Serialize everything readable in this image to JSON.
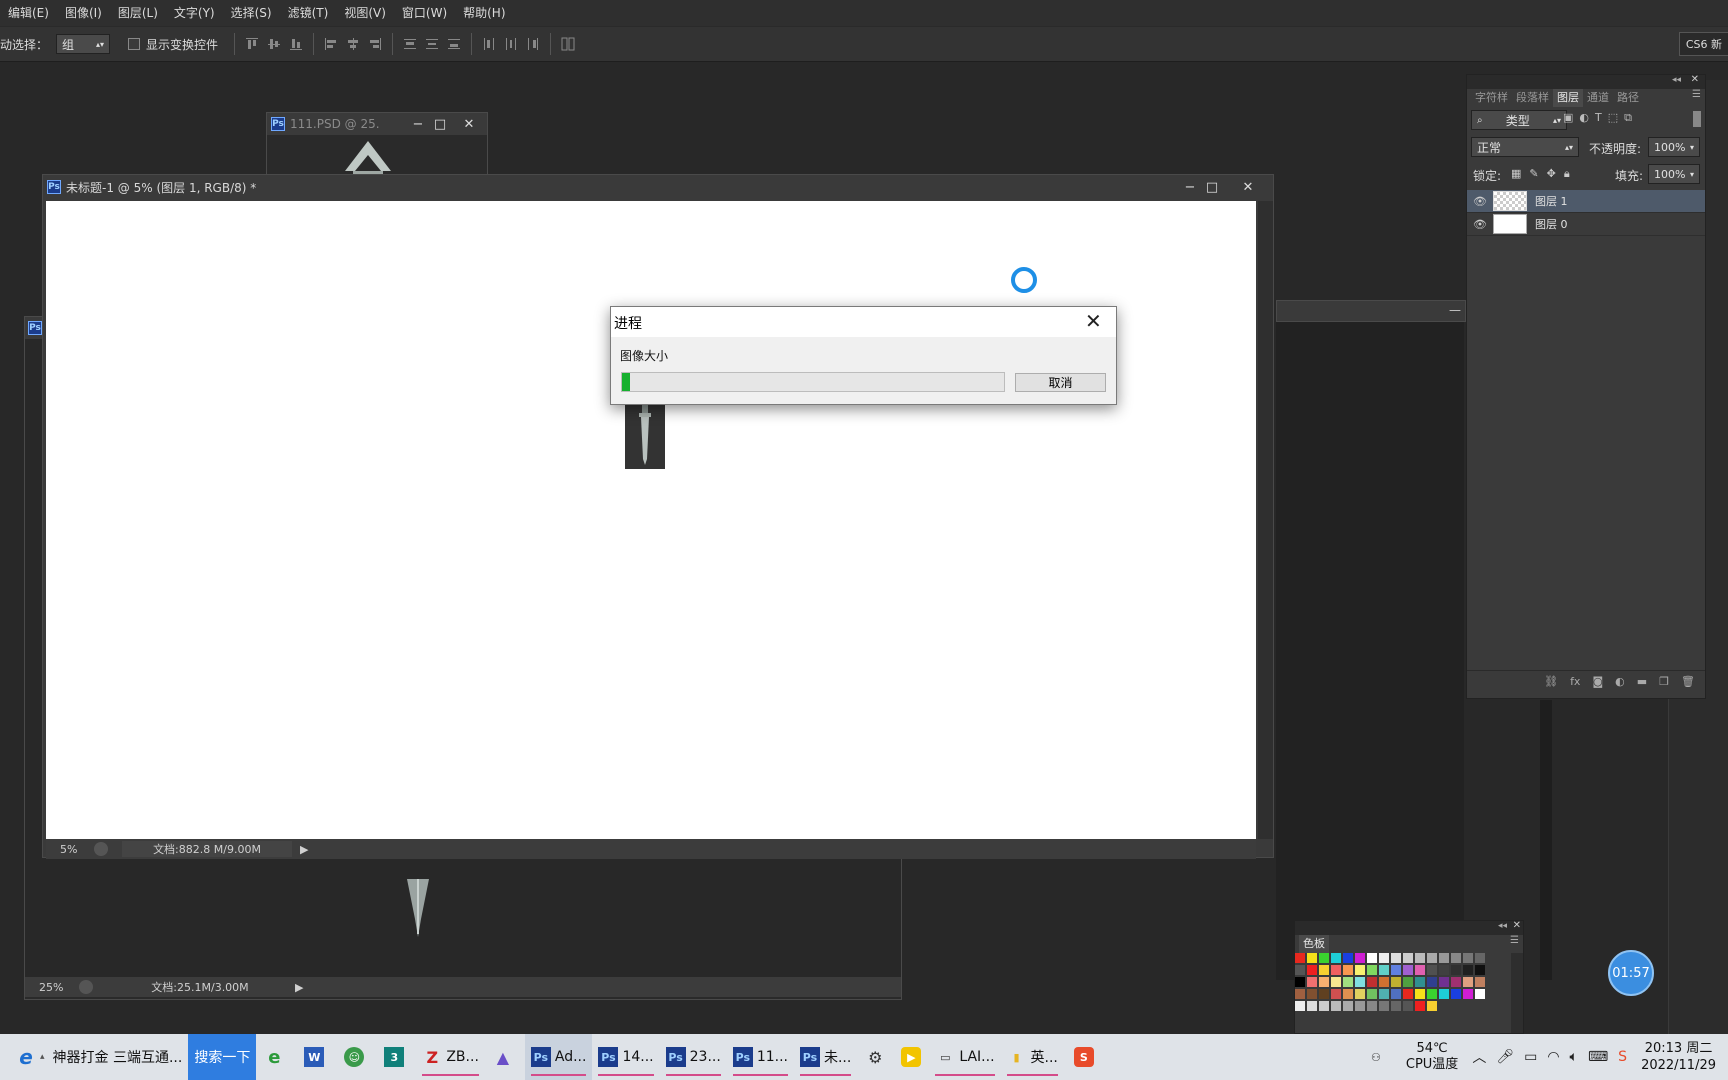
{
  "menu": [
    "编辑(E)",
    "图像(I)",
    "图层(L)",
    "文字(Y)",
    "选择(S)",
    "滤镜(T)",
    "视图(V)",
    "窗口(W)",
    "帮助(H)"
  ],
  "options": {
    "auto_select_label": "动选择：",
    "auto_select_value": "组",
    "show_transform_label": "显示变换控件",
    "workspace_label": "CS6 新"
  },
  "bg_window_1": {
    "title": "111.PSD @ 25..."
  },
  "bg_window_2": {
    "zoom": "25%",
    "doc_info": "文档:25.1M/3.00M"
  },
  "main_window": {
    "title": "未标题-1 @ 5% (图层 1, RGB/8) *",
    "zoom": "5%",
    "doc_info": "文档:882.8 M/9.00M"
  },
  "dialog": {
    "title": "进程",
    "message": "图像大小",
    "progress": 0.02,
    "cancel_label": "取消",
    "progress_color": "#16b02e"
  },
  "layers_panel": {
    "tabs": [
      "字符样",
      "段落样",
      "图层",
      "通道",
      "路径"
    ],
    "active_tab": "图层",
    "filter_label": "类型",
    "blend_mode": "正常",
    "opacity_label": "不透明度:",
    "opacity_value": "100%",
    "lock_label": "锁定:",
    "fill_label": "填充:",
    "fill_value": "100%",
    "layers": [
      {
        "name": "图层 1",
        "selected": true,
        "transparent": true
      },
      {
        "name": "图层 0",
        "selected": false,
        "transparent": false
      }
    ]
  },
  "swatches_panel": {
    "title": "色板"
  },
  "timer": "01:57",
  "taskbar": {
    "browser_search_text": "神器打金  三端互通...",
    "search_button": "搜索一下",
    "apps": [
      {
        "label": "ZB...",
        "icon": "zbrush-icon"
      },
      {
        "label": "Ad...",
        "icon": "photoshop-icon"
      },
      {
        "label": "14...",
        "icon": "photoshop-icon"
      },
      {
        "label": "23...",
        "icon": "photoshop-icon"
      },
      {
        "label": "11...",
        "icon": "photoshop-icon"
      },
      {
        "label": "未...",
        "icon": "photoshop-icon"
      },
      {
        "label": "LAI...",
        "icon": "laptop-icon"
      },
      {
        "label": "英...",
        "icon": "folder-icon"
      }
    ],
    "temperature": "54℃",
    "cpu_label": "CPU温度",
    "time": "20:13 周二",
    "date": "2022/11/29"
  }
}
